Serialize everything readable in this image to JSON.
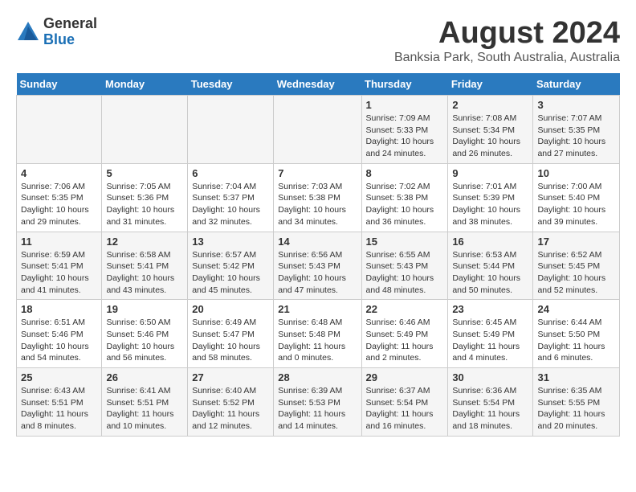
{
  "header": {
    "logo_general": "General",
    "logo_blue": "Blue",
    "title": "August 2024",
    "subtitle": "Banksia Park, South Australia, Australia"
  },
  "calendar": {
    "days_of_week": [
      "Sunday",
      "Monday",
      "Tuesday",
      "Wednesday",
      "Thursday",
      "Friday",
      "Saturday"
    ],
    "weeks": [
      {
        "days": [
          {
            "num": "",
            "info": ""
          },
          {
            "num": "",
            "info": ""
          },
          {
            "num": "",
            "info": ""
          },
          {
            "num": "",
            "info": ""
          },
          {
            "num": "1",
            "info": "Sunrise: 7:09 AM\nSunset: 5:33 PM\nDaylight: 10 hours\nand 24 minutes."
          },
          {
            "num": "2",
            "info": "Sunrise: 7:08 AM\nSunset: 5:34 PM\nDaylight: 10 hours\nand 26 minutes."
          },
          {
            "num": "3",
            "info": "Sunrise: 7:07 AM\nSunset: 5:35 PM\nDaylight: 10 hours\nand 27 minutes."
          }
        ]
      },
      {
        "days": [
          {
            "num": "4",
            "info": "Sunrise: 7:06 AM\nSunset: 5:35 PM\nDaylight: 10 hours\nand 29 minutes."
          },
          {
            "num": "5",
            "info": "Sunrise: 7:05 AM\nSunset: 5:36 PM\nDaylight: 10 hours\nand 31 minutes."
          },
          {
            "num": "6",
            "info": "Sunrise: 7:04 AM\nSunset: 5:37 PM\nDaylight: 10 hours\nand 32 minutes."
          },
          {
            "num": "7",
            "info": "Sunrise: 7:03 AM\nSunset: 5:38 PM\nDaylight: 10 hours\nand 34 minutes."
          },
          {
            "num": "8",
            "info": "Sunrise: 7:02 AM\nSunset: 5:38 PM\nDaylight: 10 hours\nand 36 minutes."
          },
          {
            "num": "9",
            "info": "Sunrise: 7:01 AM\nSunset: 5:39 PM\nDaylight: 10 hours\nand 38 minutes."
          },
          {
            "num": "10",
            "info": "Sunrise: 7:00 AM\nSunset: 5:40 PM\nDaylight: 10 hours\nand 39 minutes."
          }
        ]
      },
      {
        "days": [
          {
            "num": "11",
            "info": "Sunrise: 6:59 AM\nSunset: 5:41 PM\nDaylight: 10 hours\nand 41 minutes."
          },
          {
            "num": "12",
            "info": "Sunrise: 6:58 AM\nSunset: 5:41 PM\nDaylight: 10 hours\nand 43 minutes."
          },
          {
            "num": "13",
            "info": "Sunrise: 6:57 AM\nSunset: 5:42 PM\nDaylight: 10 hours\nand 45 minutes."
          },
          {
            "num": "14",
            "info": "Sunrise: 6:56 AM\nSunset: 5:43 PM\nDaylight: 10 hours\nand 47 minutes."
          },
          {
            "num": "15",
            "info": "Sunrise: 6:55 AM\nSunset: 5:43 PM\nDaylight: 10 hours\nand 48 minutes."
          },
          {
            "num": "16",
            "info": "Sunrise: 6:53 AM\nSunset: 5:44 PM\nDaylight: 10 hours\nand 50 minutes."
          },
          {
            "num": "17",
            "info": "Sunrise: 6:52 AM\nSunset: 5:45 PM\nDaylight: 10 hours\nand 52 minutes."
          }
        ]
      },
      {
        "days": [
          {
            "num": "18",
            "info": "Sunrise: 6:51 AM\nSunset: 5:46 PM\nDaylight: 10 hours\nand 54 minutes."
          },
          {
            "num": "19",
            "info": "Sunrise: 6:50 AM\nSunset: 5:46 PM\nDaylight: 10 hours\nand 56 minutes."
          },
          {
            "num": "20",
            "info": "Sunrise: 6:49 AM\nSunset: 5:47 PM\nDaylight: 10 hours\nand 58 minutes."
          },
          {
            "num": "21",
            "info": "Sunrise: 6:48 AM\nSunset: 5:48 PM\nDaylight: 11 hours\nand 0 minutes."
          },
          {
            "num": "22",
            "info": "Sunrise: 6:46 AM\nSunset: 5:49 PM\nDaylight: 11 hours\nand 2 minutes."
          },
          {
            "num": "23",
            "info": "Sunrise: 6:45 AM\nSunset: 5:49 PM\nDaylight: 11 hours\nand 4 minutes."
          },
          {
            "num": "24",
            "info": "Sunrise: 6:44 AM\nSunset: 5:50 PM\nDaylight: 11 hours\nand 6 minutes."
          }
        ]
      },
      {
        "days": [
          {
            "num": "25",
            "info": "Sunrise: 6:43 AM\nSunset: 5:51 PM\nDaylight: 11 hours\nand 8 minutes."
          },
          {
            "num": "26",
            "info": "Sunrise: 6:41 AM\nSunset: 5:51 PM\nDaylight: 11 hours\nand 10 minutes."
          },
          {
            "num": "27",
            "info": "Sunrise: 6:40 AM\nSunset: 5:52 PM\nDaylight: 11 hours\nand 12 minutes."
          },
          {
            "num": "28",
            "info": "Sunrise: 6:39 AM\nSunset: 5:53 PM\nDaylight: 11 hours\nand 14 minutes."
          },
          {
            "num": "29",
            "info": "Sunrise: 6:37 AM\nSunset: 5:54 PM\nDaylight: 11 hours\nand 16 minutes."
          },
          {
            "num": "30",
            "info": "Sunrise: 6:36 AM\nSunset: 5:54 PM\nDaylight: 11 hours\nand 18 minutes."
          },
          {
            "num": "31",
            "info": "Sunrise: 6:35 AM\nSunset: 5:55 PM\nDaylight: 11 hours\nand 20 minutes."
          }
        ]
      }
    ]
  }
}
